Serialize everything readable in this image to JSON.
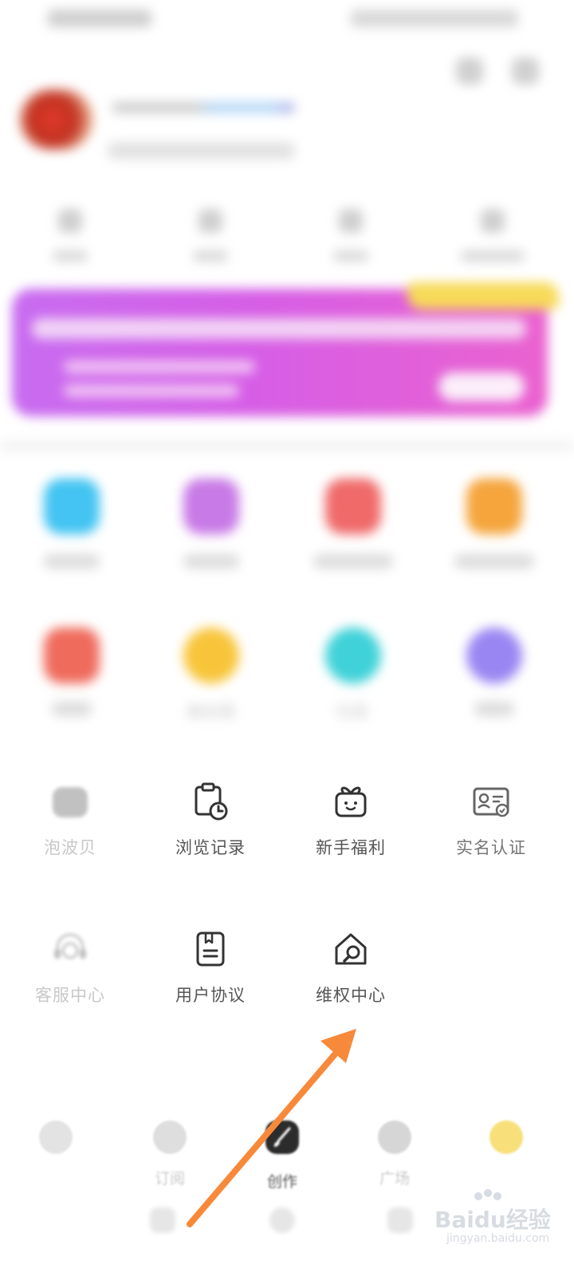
{
  "grid_row3": [
    {
      "label": "泡波贝",
      "icon": "shell-icon"
    },
    {
      "label": "浏览记录",
      "icon": "clock-history-icon"
    },
    {
      "label": "新手福利",
      "icon": "gift-icon"
    },
    {
      "label": "实名认证",
      "icon": "id-card-icon"
    }
  ],
  "grid_row4": [
    {
      "label": "客服中心",
      "icon": "headset-icon"
    },
    {
      "label": "用户协议",
      "icon": "agreement-icon"
    },
    {
      "label": "维权中心",
      "icon": "rights-center-icon"
    }
  ],
  "grid_row2_visible": [
    "触友圈",
    "社团"
  ],
  "tabs": [
    {
      "label": "",
      "icon": "home-icon"
    },
    {
      "label": "订阅",
      "icon": "subscribe-icon"
    },
    {
      "label": "创作",
      "icon": "brush-icon"
    },
    {
      "label": "广场",
      "icon": "heart-chat-icon"
    },
    {
      "label": "",
      "icon": "profile-icon"
    }
  ],
  "watermark": {
    "brand": "Baidu经验",
    "url": "jingyan.baidu.com"
  },
  "colors": {
    "banner_start": "#c86cf0",
    "banner_end": "#ea62cf",
    "arrow": "#f7893a",
    "tag": "#f7da58"
  }
}
